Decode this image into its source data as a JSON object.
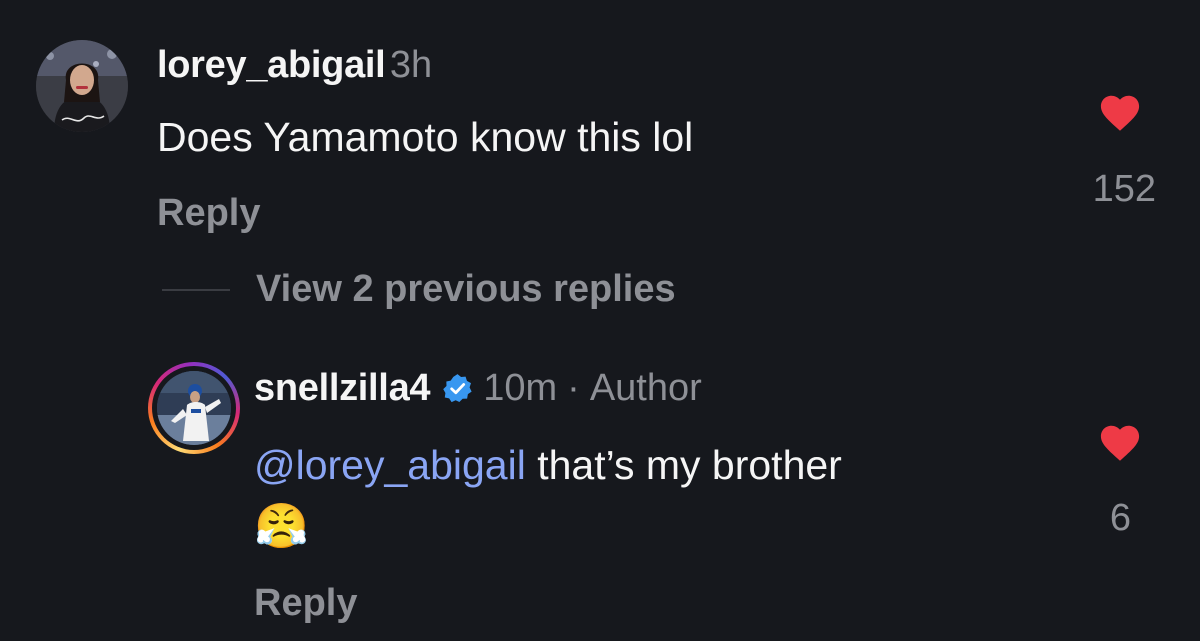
{
  "comment": {
    "username": "lorey_abigail",
    "time": "3h",
    "text": "Does Yamamoto know this lol",
    "reply_label": "Reply",
    "like_count": "152",
    "avatar_icon": "profile-photo-icon"
  },
  "view_replies": {
    "label": "View 2 previous replies"
  },
  "reply": {
    "username": "snellzilla4",
    "verified_icon": "verified-badge-icon",
    "time": "10m",
    "separator": "·",
    "author_label": "Author",
    "mention": "@lorey_abigail",
    "text": "that’s my brother",
    "emoji": "😤",
    "reply_label": "Reply",
    "like_count": "6"
  },
  "colors": {
    "background": "#16181d",
    "primary_text": "#f5f5f5",
    "secondary_text": "#8e9096",
    "mention": "#8aa5f4",
    "heart": "#ee3a46",
    "verified": "#3897f0"
  }
}
